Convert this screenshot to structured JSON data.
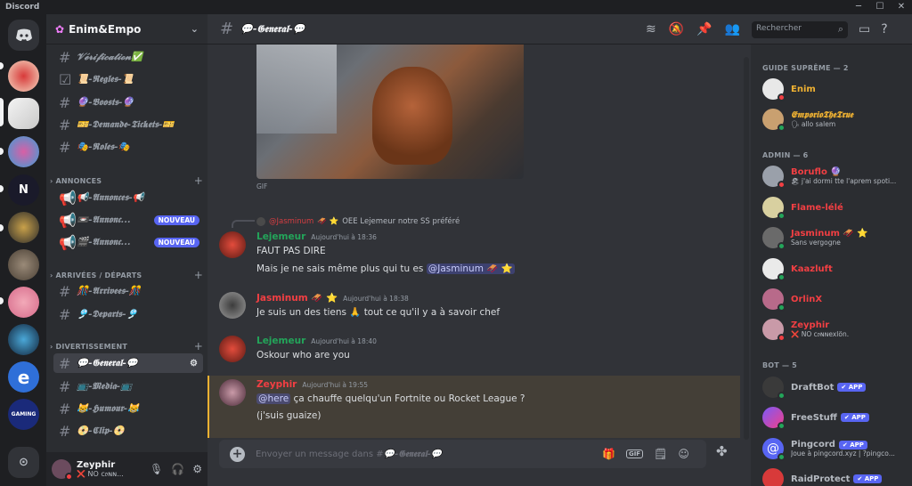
{
  "window": {
    "title": "Discord"
  },
  "guild": {
    "name": "Enim&Empo"
  },
  "channels": {
    "top": [
      {
        "name": "𝓥𝓮́𝓻𝓲𝓯𝓲𝓬𝓪𝓽𝓲𝓸𝓷✅"
      },
      {
        "name": "📜-𝕽𝖊𝖌𝖑𝖊𝖘-📜"
      },
      {
        "name": "🔮-𝕭𝖔𝖔𝖘𝖙𝖘-🔮"
      },
      {
        "name": "🎫-𝕯𝖊𝖒𝖆𝖓𝖉𝖊-𝕿𝖎𝖈𝖐𝖊𝖙𝖘-🎫"
      },
      {
        "name": "🎭-𝕽𝖔𝖑𝖊𝖘-🎭"
      }
    ],
    "cat_annonces": "ANNONCES",
    "annonces": [
      {
        "name": "📢-𝕬𝖓𝖓𝖔𝖓𝖈𝖊𝖘-📢",
        "badge": ""
      },
      {
        "name": "📼-𝕬𝖓𝖓𝖔𝖓𝖈...",
        "badge": "NOUVEAU"
      },
      {
        "name": "🎬-𝕬𝖓𝖓𝖔𝖓𝖈...",
        "badge": "NOUVEAU"
      }
    ],
    "cat_arrivees": "ARRIVÉES / DÉPARTS",
    "arrivees": [
      {
        "name": "🎊-𝕬𝖗𝖗𝖎𝖛𝖊𝖊𝖘-🎊"
      },
      {
        "name": "🎐-𝕯𝖊𝖕𝖆𝖗𝖙𝖘-🎐"
      }
    ],
    "cat_divert": "DIVERTISSEMENT",
    "divert": [
      {
        "name": "💬-𝕲𝖊𝖓𝖊𝖗𝖆𝖑-💬"
      },
      {
        "name": "📺-𝕸𝖊𝖉𝖎𝖆-📺"
      },
      {
        "name": "😹-𝕳𝖚𝖒𝖔𝖚𝖗-😹"
      },
      {
        "name": "📀-𝕮𝖑𝖎𝖕-📀"
      }
    ]
  },
  "user": {
    "name": "Zeyphir",
    "status": "❌ NO c𝔬ɴɴ..."
  },
  "topbar": {
    "channel": "💬-𝕲𝖊𝖓𝖊𝖗𝖆𝖑-💬",
    "search_placeholder": "Rechercher"
  },
  "messages": {
    "gif_label": "GIF",
    "reply": {
      "name": "@Jasminum",
      "text": "OEE Lejemeur notre SS préféré"
    },
    "m1": {
      "author": "Lejemeur",
      "time": "Aujourd'hui à 18:36",
      "line1": "FAUT PAS DIRE",
      "line2": "Mais je ne sais même plus qui tu es",
      "mention": "@Jasminum 🛷 ⭐"
    },
    "m2": {
      "author": "Jasminum 🛷 ⭐",
      "time": "Aujourd'hui à 18:38",
      "line1": "Je suis un des tiens 🙏 tout ce qu'il y a à savoir chef"
    },
    "m3": {
      "author": "Lejemeur",
      "time": "Aujourd'hui à 18:40",
      "line1": "Oskour who are you"
    },
    "m4": {
      "author": "Zeyphir",
      "time": "Aujourd'hui à 19:55",
      "mention": "@here",
      "line1": " ça chauffe quelqu'un Fortnite ou Rocket League ?",
      "line2": "(j'suis guaize)"
    }
  },
  "composer": {
    "placeholder": "Envoyer un message dans #",
    "channel": "💬-𝕲𝖊𝖓𝖊𝖗𝖆𝖑-💬",
    "gif": "GIF"
  },
  "members": {
    "cat1": "GUIDE SUPRÊME — 2",
    "cat2": "ADMIN — 6",
    "cat3": "BOT — 5",
    "list": [
      {
        "name": "Enim",
        "status": "",
        "color": "#f0b232"
      },
      {
        "name": "𝕰𝖒𝖕𝖔𝖗𝖎𝖔𝕿𝖍𝖊𝕿𝖗𝖚𝖊",
        "status": "🗣 allo salem",
        "color": "#f0b232"
      },
      {
        "name": "Boruflo 🔮",
        "status": "🏖 j'ai dormi tte l'aprem spoti...",
        "color": "#f23f43"
      },
      {
        "name": "Flame-lélé",
        "status": "",
        "color": "#f23f43"
      },
      {
        "name": "Jasminum 🛷 ⭐",
        "status": "Sans vergogne",
        "color": "#f23f43"
      },
      {
        "name": "Kaazluft",
        "status": "",
        "color": "#f23f43"
      },
      {
        "name": "OrlinX",
        "status": "",
        "color": "#f23f43"
      },
      {
        "name": "Zeyphir",
        "status": "❌ NO c𝔬ɴɴexlön.",
        "color": "#f23f43"
      },
      {
        "name": "DraftBot",
        "status": "",
        "color": "#b5bac1"
      },
      {
        "name": "FreeStuff",
        "status": "",
        "color": "#b5bac1"
      },
      {
        "name": "Pingcord",
        "status": "Joue à pingcord.xyz | ?pingco...",
        "color": "#b5bac1"
      },
      {
        "name": "RaidProtect",
        "status": "",
        "color": "#b5bac1"
      }
    ],
    "app_label": "✔ APP"
  },
  "colors": {
    "accent": "#5865f2",
    "admin": "#f23f43",
    "guide": "#f0b232",
    "bg": "#313338"
  }
}
